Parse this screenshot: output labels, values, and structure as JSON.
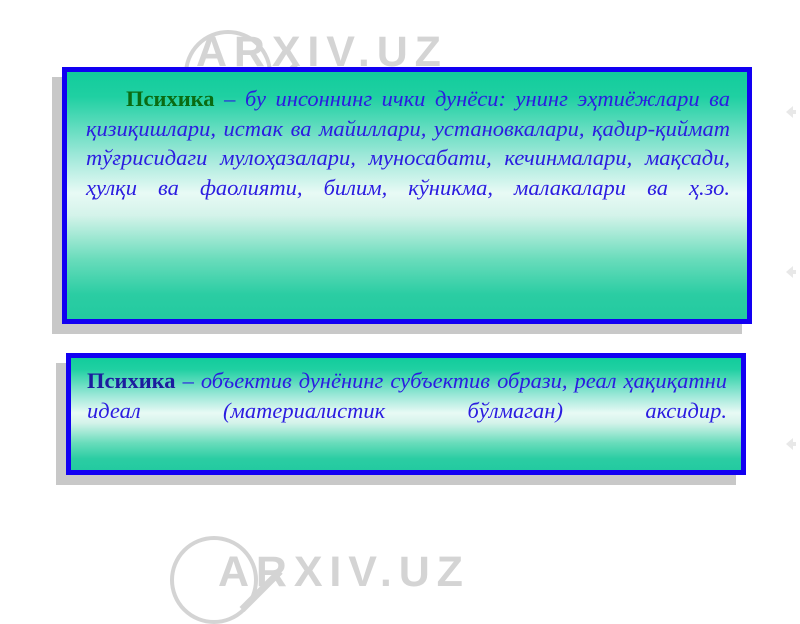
{
  "slide": {
    "background_color": "#ffffff",
    "watermark": {
      "text": "ARXIV.UZ",
      "icon": "magnifier-icon",
      "color": "#d4d4d4",
      "occurrences": 3
    },
    "edge_marks": {
      "icon": "arrow-left-icon",
      "color": "#e2e2e2",
      "count": 3
    },
    "boxes": [
      {
        "id": "definition-box-1",
        "keyword": "Психика",
        "keyword_color": "#0a6b12",
        "dash": " – ",
        "body": "бу инсоннинг ички дунёси: унинг эҳтиёжлари ва қизиқишлари, истак ва майиллари, установкалари, қадир-қиймат тўғрисидаги мулоҳазалари, муносабати, кечинмалари, мақсади, ҳулқи ва фаолияти, билим, кўникма, малакалари ва ҳ.зо.",
        "body_color": "#2b1ce0",
        "border_color": "#1200f2",
        "fill_top_color": "#12cc9c",
        "fill_mid_color": "#e8faf5",
        "fill_bottom_color": "#23caa0",
        "shadow_color": "#bebebe"
      },
      {
        "id": "definition-box-2",
        "keyword": "Психика",
        "keyword_color": "#1c1c9e",
        "dash": " – ",
        "body": "объектив дунёнинг субъектив образи, реал ҳақиқатни идеал (материалистик бўлмаган) аксидир.",
        "body_color": "#2b1ce0",
        "border_color": "#1200f2",
        "fill_top_color": "#12cc9c",
        "fill_mid_color": "#e8faf5",
        "fill_bottom_color": "#23caa0",
        "shadow_color": "#bebebe"
      }
    ]
  }
}
